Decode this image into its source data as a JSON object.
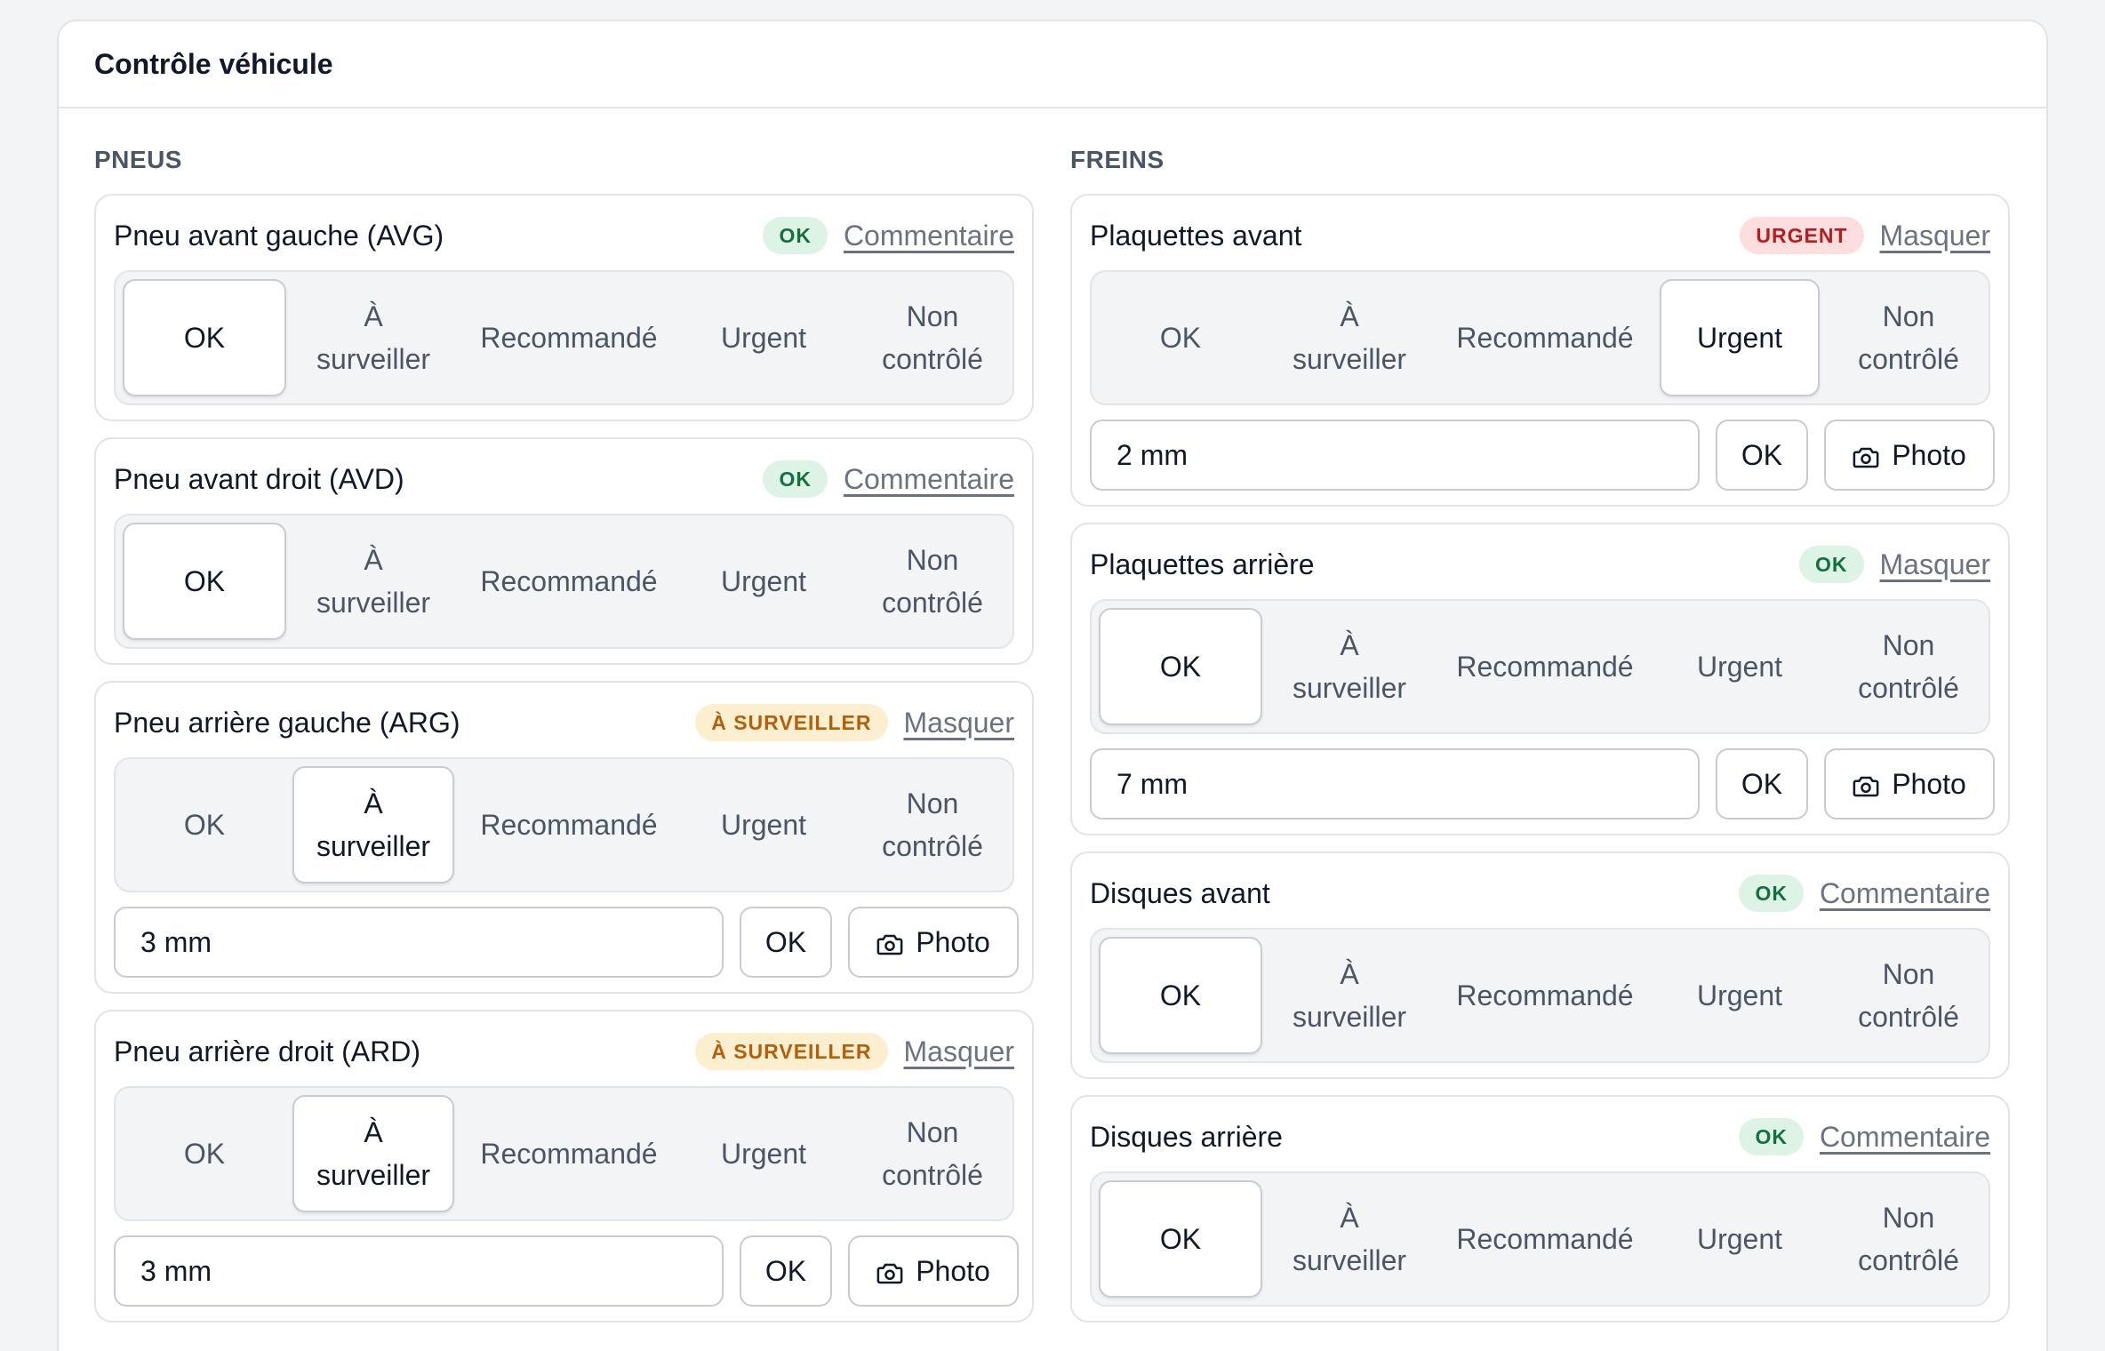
{
  "title": "Contrôle véhicule",
  "options": [
    "OK",
    "À\nsurveiller",
    "Recommandé",
    "Urgent",
    "Non\ncontrôlé"
  ],
  "columns": [
    {
      "title": "PNEUS",
      "items": [
        {
          "name": "Pneu avant gauche (AVG)",
          "badge": "OK",
          "badge_type": "ok",
          "link": "Commentaire",
          "selected": 0,
          "measure": null
        },
        {
          "name": "Pneu avant droit (AVD)",
          "badge": "OK",
          "badge_type": "ok",
          "link": "Commentaire",
          "selected": 0,
          "measure": null
        },
        {
          "name": "Pneu arrière gauche (ARG)",
          "badge": "À SURVEILLER",
          "badge_type": "watch",
          "link": "Masquer",
          "selected": 1,
          "measure": "3 mm"
        },
        {
          "name": "Pneu arrière droit (ARD)",
          "badge": "À SURVEILLER",
          "badge_type": "watch",
          "link": "Masquer",
          "selected": 1,
          "measure": "3 mm"
        }
      ]
    },
    {
      "title": "FREINS",
      "items": [
        {
          "name": "Plaquettes avant",
          "badge": "URGENT",
          "badge_type": "urgent",
          "link": "Masquer",
          "selected": 3,
          "measure": "2 mm"
        },
        {
          "name": "Plaquettes arrière",
          "badge": "OK",
          "badge_type": "ok",
          "link": "Masquer",
          "selected": 0,
          "measure": "7 mm"
        },
        {
          "name": "Disques avant",
          "badge": "OK",
          "badge_type": "ok",
          "link": "Commentaire",
          "selected": 0,
          "measure": null
        },
        {
          "name": "Disques arrière",
          "badge": "OK",
          "badge_type": "ok",
          "link": "Commentaire",
          "selected": 0,
          "measure": null
        }
      ]
    }
  ],
  "buttons": {
    "ok": "OK",
    "photo": "Photo"
  },
  "icons": {
    "photo": "camera-icon"
  }
}
